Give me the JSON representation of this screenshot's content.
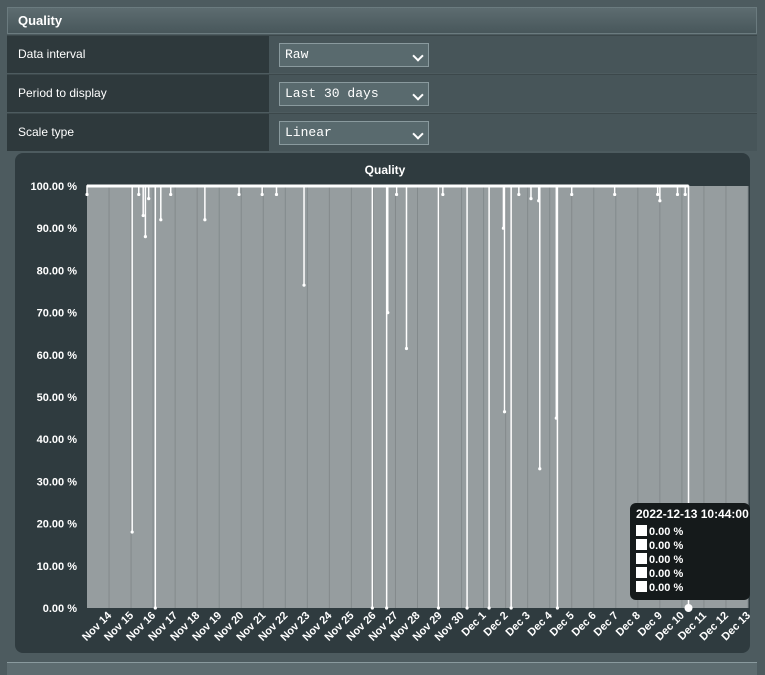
{
  "header": {
    "title": "Quality"
  },
  "settings": [
    {
      "label": "Data interval",
      "value": "Raw"
    },
    {
      "label": "Period to display",
      "value": "Last 30 days"
    },
    {
      "label": "Scale type",
      "value": "Linear"
    }
  ],
  "tooltip": {
    "title": "2022-12-13 10:44:00",
    "lines": [
      "0.00 %",
      "0.00 %",
      "0.00 %",
      "0.00 %",
      "0.00 %"
    ]
  },
  "colors": {
    "plot_bg": "#969d9f",
    "line": "#ffffff",
    "panel": "#2f3b3f"
  },
  "chart_data": {
    "type": "line",
    "title": "Quality",
    "xlabel": "",
    "ylabel": "",
    "ylim": [
      0,
      100
    ],
    "y_ticks": [
      "0.00 %",
      "10.00 %",
      "20.00 %",
      "30.00 %",
      "40.00 %",
      "50.00 %",
      "60.00 %",
      "70.00 %",
      "80.00 %",
      "90.00 %",
      "100.00 %"
    ],
    "categories": [
      "Nov 14",
      "Nov 15",
      "Nov 16",
      "Nov 17",
      "Nov 18",
      "Nov 19",
      "Nov 20",
      "Nov 21",
      "Nov 22",
      "Nov 23",
      "Nov 24",
      "Nov 25",
      "Nov 26",
      "Nov 27",
      "Nov 28",
      "Nov 29",
      "Nov 30",
      "Dec 1",
      "Dec 2",
      "Dec 3",
      "Dec 4",
      "Dec 5",
      "Dec 6",
      "Dec 7",
      "Dec 8",
      "Dec 9",
      "Dec 10",
      "Dec 11",
      "Dec 12",
      "Dec 13"
    ],
    "grid": true,
    "baseline": 100,
    "dips": [
      {
        "x": 13.0,
        "y": 98
      },
      {
        "x": 15.05,
        "y": 18
      },
      {
        "x": 15.35,
        "y": 98
      },
      {
        "x": 15.55,
        "y": 93
      },
      {
        "x": 15.65,
        "y": 88
      },
      {
        "x": 15.8,
        "y": 97
      },
      {
        "x": 16.1,
        "y": 0
      },
      {
        "x": 16.35,
        "y": 92
      },
      {
        "x": 16.8,
        "y": 98
      },
      {
        "x": 18.35,
        "y": 92
      },
      {
        "x": 19.9,
        "y": 98
      },
      {
        "x": 20.95,
        "y": 98
      },
      {
        "x": 21.6,
        "y": 98
      },
      {
        "x": 22.85,
        "y": 76.5
      },
      {
        "x": 25.95,
        "y": 0
      },
      {
        "x": 26.6,
        "y": 0
      },
      {
        "x": 26.65,
        "y": 70
      },
      {
        "x": 27.05,
        "y": 98
      },
      {
        "x": 27.5,
        "y": 61.5
      },
      {
        "x": 28.95,
        "y": 0
      },
      {
        "x": 29.15,
        "y": 98
      },
      {
        "x": 30.25,
        "y": 0
      },
      {
        "x": 31.25,
        "y": 0
      },
      {
        "x": 31.9,
        "y": 90
      },
      {
        "x": 31.95,
        "y": 46.5
      },
      {
        "x": 32.25,
        "y": 0
      },
      {
        "x": 32.6,
        "y": 98
      },
      {
        "x": 33.15,
        "y": 97
      },
      {
        "x": 33.5,
        "y": 96.5
      },
      {
        "x": 33.55,
        "y": 33
      },
      {
        "x": 34.3,
        "y": 45
      },
      {
        "x": 34.35,
        "y": 0
      },
      {
        "x": 35.0,
        "y": 98
      },
      {
        "x": 36.95,
        "y": 98
      },
      {
        "x": 38.9,
        "y": 98
      },
      {
        "x": 39.0,
        "y": 96.5
      },
      {
        "x": 39.8,
        "y": 98
      },
      {
        "x": 40.15,
        "y": 98
      },
      {
        "x": 40.3,
        "y": 0
      }
    ],
    "x_start": 13,
    "x_end": 40.3
  }
}
